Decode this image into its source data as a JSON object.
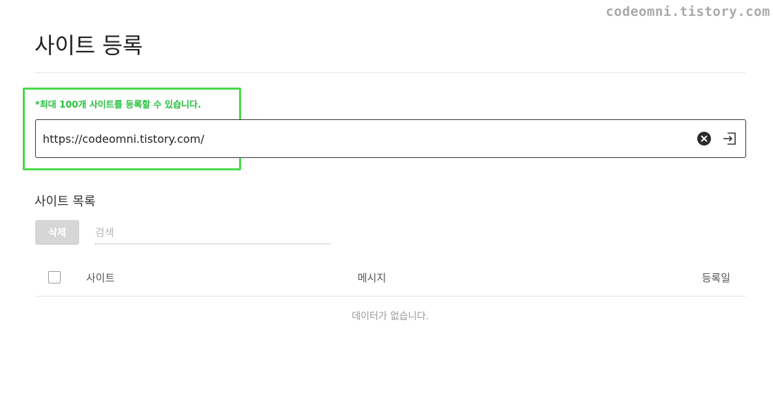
{
  "watermark": "codeomni.tistory.com",
  "page": {
    "title": "사이트 등록"
  },
  "register": {
    "limit_note": "*최대 100개 사이트를 등록할 수 있습니다.",
    "url_value": "https://codeomni.tistory.com/",
    "clear_icon": "clear-circle-icon",
    "submit_icon": "enter-icon"
  },
  "site_list": {
    "title": "사이트 목록",
    "delete_label": "삭제",
    "search_placeholder": "검색",
    "columns": {
      "site": "사이트",
      "message": "메시지",
      "date": "등록일"
    },
    "empty_message": "데이터가 없습니다."
  },
  "colors": {
    "highlight": "#4ad94a",
    "note_green": "#22c13a"
  }
}
